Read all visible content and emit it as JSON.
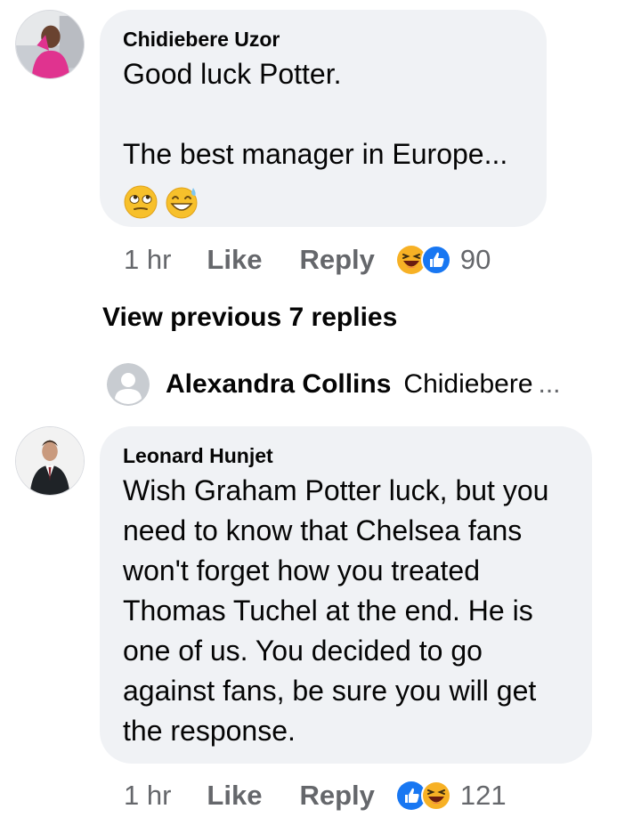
{
  "comments": [
    {
      "author": "Chidiebere Uzor",
      "text": "Good luck Potter.\n\nThe best manager in Europe...",
      "emojis": [
        "face-with-rolling-eyes-icon",
        "grinning-face-with-sweat-icon"
      ],
      "time": "1 hr",
      "like_label": "Like",
      "reply_label": "Reply",
      "reactions": [
        "haha-reaction-icon",
        "like-reaction-icon"
      ],
      "reaction_count": "90"
    },
    {
      "author": "Leonard Hunjet",
      "text": "Wish Graham Potter luck, but you\nneed to know that Chelsea fans\nwon't forget how you treated\nThomas Tuchel at the end. He is\none of us. You decided to go\nagainst fans, be sure you will get\nthe response.",
      "time": "1 hr",
      "like_label": "Like",
      "reply_label": "Reply",
      "reactions": [
        "like-reaction-icon",
        "haha-reaction-icon"
      ],
      "reaction_count": "121"
    }
  ],
  "replies": {
    "view_previous_label": "View previous 7 replies",
    "preview": {
      "author": "Alexandra Collins",
      "text": "Chidiebere",
      "ellipsis": "..."
    }
  },
  "colors": {
    "bubble": "#f0f2f5",
    "secondary_text": "#65676b",
    "like_blue": "#1877f2",
    "haha_yellow": "#f7b125"
  }
}
